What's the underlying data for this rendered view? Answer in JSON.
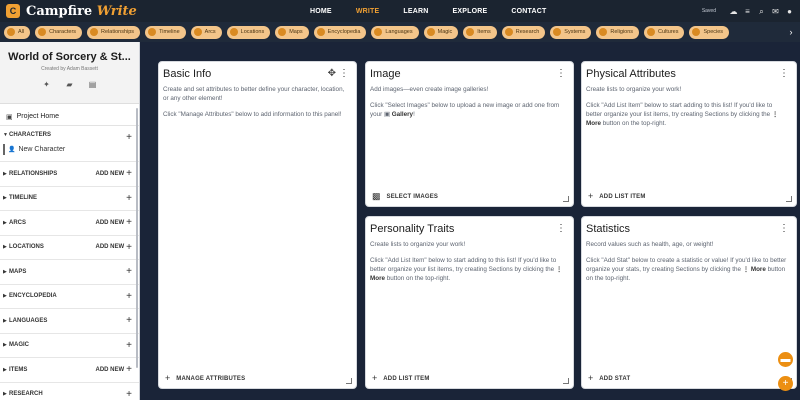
{
  "app": {
    "logo_letter": "C",
    "name_main": "Campfire",
    "name_accent": "Write"
  },
  "nav": {
    "links": [
      "HOME",
      "WRITE",
      "LEARN",
      "EXPLORE",
      "CONTACT"
    ],
    "active": "WRITE",
    "saved_text": "Saved",
    "icons": [
      "cloud-icon",
      "search-icon",
      "mail-icon",
      "user-icon",
      "menu-icon"
    ]
  },
  "categories": [
    "All",
    "Characters",
    "Relationships",
    "Timeline",
    "Arcs",
    "Locations",
    "Maps",
    "Encyclopedia",
    "Languages",
    "Magic",
    "Items",
    "Research",
    "Systems",
    "Religions",
    "Cultures",
    "Species"
  ],
  "sidebar": {
    "world_title": "World of Sorcery & St...",
    "creator": "Created by Adam Bassett",
    "project_home": "Project Home",
    "new_character": "New Character",
    "add_new_label": "ADD NEW",
    "sections": [
      {
        "label": "CHARACTERS",
        "add_new": false
      },
      {
        "label": "RELATIONSHIPS",
        "add_new": true
      },
      {
        "label": "TIMELINE",
        "add_new": false
      },
      {
        "label": "ARCS",
        "add_new": true
      },
      {
        "label": "LOCATIONS",
        "add_new": true
      },
      {
        "label": "MAPS",
        "add_new": false
      },
      {
        "label": "ENCYCLOPEDIA",
        "add_new": false
      },
      {
        "label": "LANGUAGES",
        "add_new": false
      },
      {
        "label": "MAGIC",
        "add_new": false
      },
      {
        "label": "ITEMS",
        "add_new": true
      },
      {
        "label": "RESEARCH",
        "add_new": false
      }
    ]
  },
  "panels": {
    "basic_info": {
      "title": "Basic Info",
      "desc1": "Create and set attributes to better define your character, location, or any other element!",
      "desc2": "Click \"Manage Attributes\" below to add information to this panel!",
      "footer": "MANAGE ATTRIBUTES"
    },
    "image": {
      "title": "Image",
      "desc1": "Add images—even create image galleries!",
      "desc2_pre": "Click \"Select Images\" below to upload a new image or add one from your",
      "desc2_bold": "Gallery",
      "footer": "SELECT IMAGES"
    },
    "physical": {
      "title": "Physical Attributes",
      "desc1": "Create lists to organize your work!",
      "desc2_pre": "Click \"Add List Item\" below to start adding to this list! If you'd like to better organize your list items, try creating Sections by clicking the",
      "desc2_bold": "More",
      "desc2_post": "button on the top-right.",
      "footer": "ADD LIST ITEM"
    },
    "personality": {
      "title": "Personality Traits",
      "desc1": "Create lists to organize your work!",
      "desc2_pre": "Click \"Add List Item\" below to start adding to this list! If you'd like to better organize your list items, try creating Sections by clicking the",
      "desc2_bold": "More",
      "desc2_post": "button on the top-right.",
      "footer": "ADD LIST ITEM"
    },
    "statistics": {
      "title": "Statistics",
      "desc1": "Record values such as health, age, or weight!",
      "desc2_pre": "Click \"Add Stat\" below to create a statistic or value! If you'd like to better organize your stats, try creating Sections by clicking the",
      "desc2_bold": "More",
      "desc2_post": "button on the top-right.",
      "footer": "ADD STAT"
    }
  },
  "colors": {
    "accent": "#ec8f12",
    "chip_bg": "#f3c58a",
    "nav_bg": "#1b2430",
    "backdrop": "#1a2438"
  }
}
